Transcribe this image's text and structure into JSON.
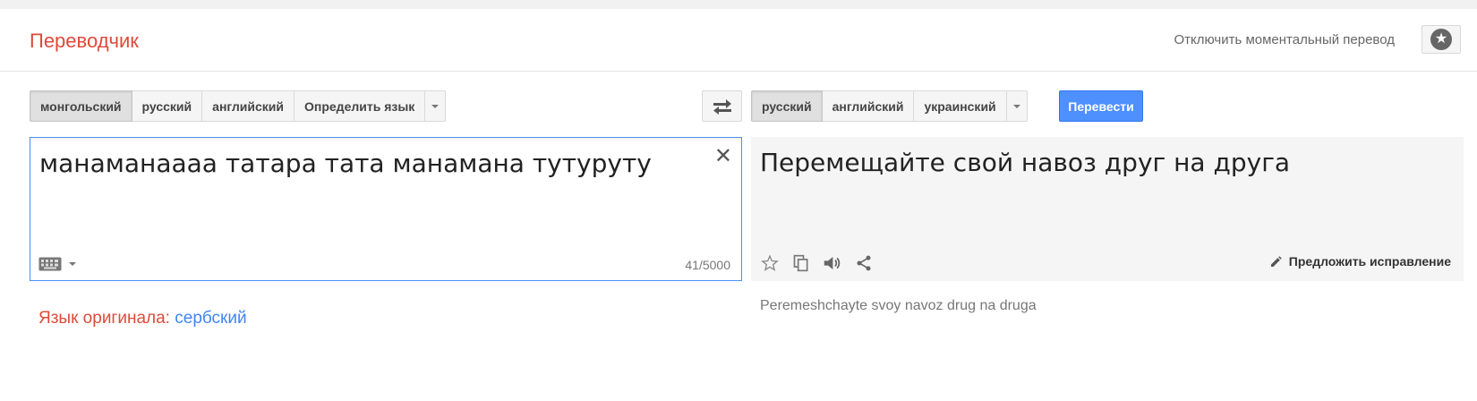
{
  "header": {
    "logo": "Переводчик",
    "instant_link": "Отключить моментальный перевод",
    "star_icon": "star-icon"
  },
  "source_langs": [
    {
      "label": "монгольский",
      "active": true
    },
    {
      "label": "русский",
      "active": false
    },
    {
      "label": "английский",
      "active": false
    },
    {
      "label": "Определить язык",
      "active": false
    }
  ],
  "target_langs": [
    {
      "label": "русский",
      "active": true
    },
    {
      "label": "английский",
      "active": false
    },
    {
      "label": "украинский",
      "active": false
    }
  ],
  "translate_button": "Перевести",
  "source": {
    "text": "манаманаааа татара тата манамана тутуруту",
    "char_count": "41/5000"
  },
  "result": {
    "text": "Перемещайте свой навоз друг на друга",
    "suggest_label": "Предложить исправление",
    "transliteration": "Peremeshchayte svoy navoz drug na druga"
  },
  "detected": {
    "label": "Язык оригинала:",
    "value": "сербский"
  },
  "colors": {
    "brand_red": "#dd4b39",
    "accent_blue": "#4d90fe",
    "link_blue": "#4285f4"
  }
}
